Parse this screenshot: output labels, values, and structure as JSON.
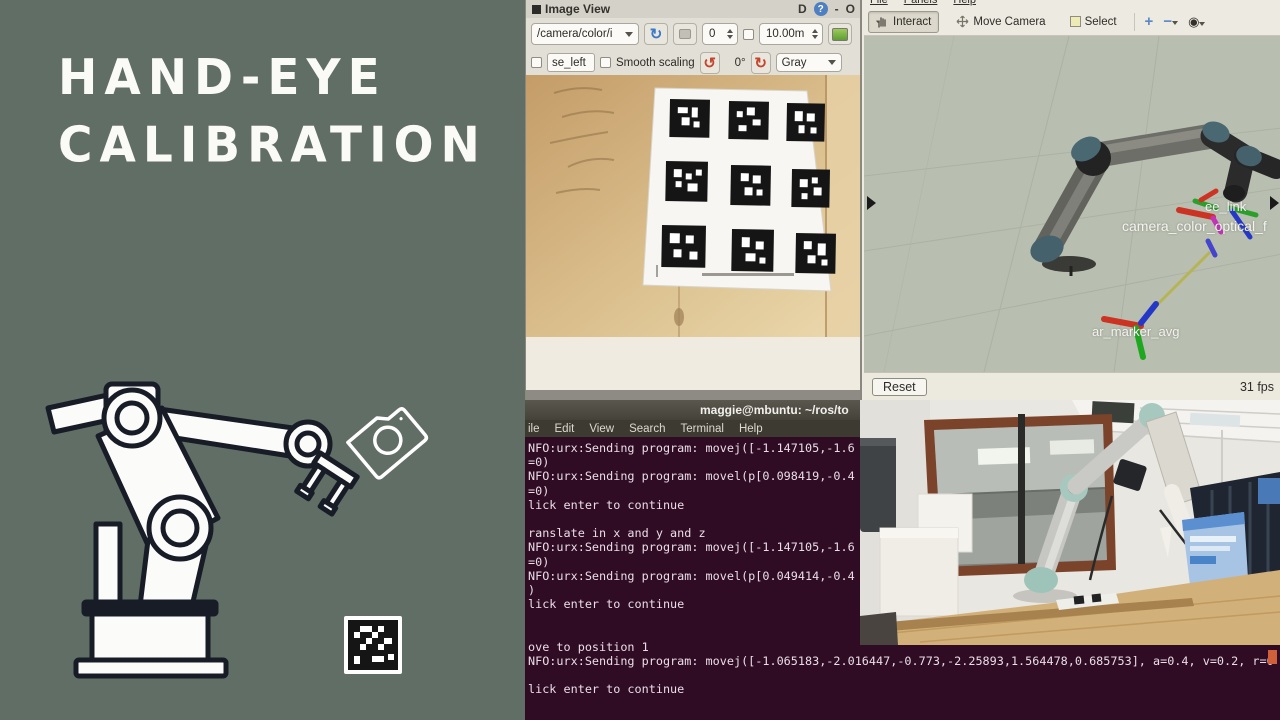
{
  "left_panel": {
    "title_line1": "HAND-EYE",
    "title_line2": "CALIBRATION"
  },
  "image_view": {
    "window_title": "Image View",
    "titlebar": {
      "dock": "D",
      "help": "?",
      "minimize": "-",
      "maximize": "O"
    },
    "topic_selected": "/camera/color/i",
    "zoom_value": "0",
    "range_value": "10.00m",
    "mouse_topic_value": "se_left",
    "smooth_scaling_label": "Smooth scaling",
    "rotation_value": "0°",
    "colormap_selected": "Gray"
  },
  "rviz": {
    "menu": [
      "File",
      "Panels",
      "Help"
    ],
    "interact_label": "Interact",
    "move_camera_label": "Move Camera",
    "select_label": "Select",
    "tf": {
      "ee_link": "ee_link",
      "camera_frame": "camera_color_optical_f",
      "marker_frame": "ar_marker_avg"
    },
    "reset_label": "Reset",
    "fps": "31 fps"
  },
  "terminal": {
    "window_title": "maggie@mbuntu: ~/ros/to",
    "menu": [
      "ile",
      "Edit",
      "View",
      "Search",
      "Terminal",
      "Help"
    ],
    "lines": [
      "NFO:urx:Sending program: movej([-1.147105,-1.6",
      "=0)",
      "NFO:urx:Sending program: movel(p[0.098419,-0.4",
      "=0)",
      "lick enter to continue",
      "",
      "ranslate in x and y and z",
      "NFO:urx:Sending program: movej([-1.147105,-1.6",
      "=0)",
      "NFO:urx:Sending program: movel(p[0.049414,-0.4",
      ")",
      "lick enter to continue",
      "",
      "",
      "ove to position 1",
      "NFO:urx:Sending program: movej([-1.065183,-2.016447,-0.773,-2.25893,1.564478,0.685753], a=0.4, v=0.2, r=0",
      "",
      "lick enter to continue"
    ]
  },
  "colors": {
    "panel_green": "#616E65",
    "terminal_bg": "#2F0C24",
    "rviz_viewport": "#B9BFB0",
    "aruco_black": "#151515",
    "tf_red": "#CC3322",
    "tf_green": "#22AA22",
    "tf_blue": "#2438C8"
  }
}
